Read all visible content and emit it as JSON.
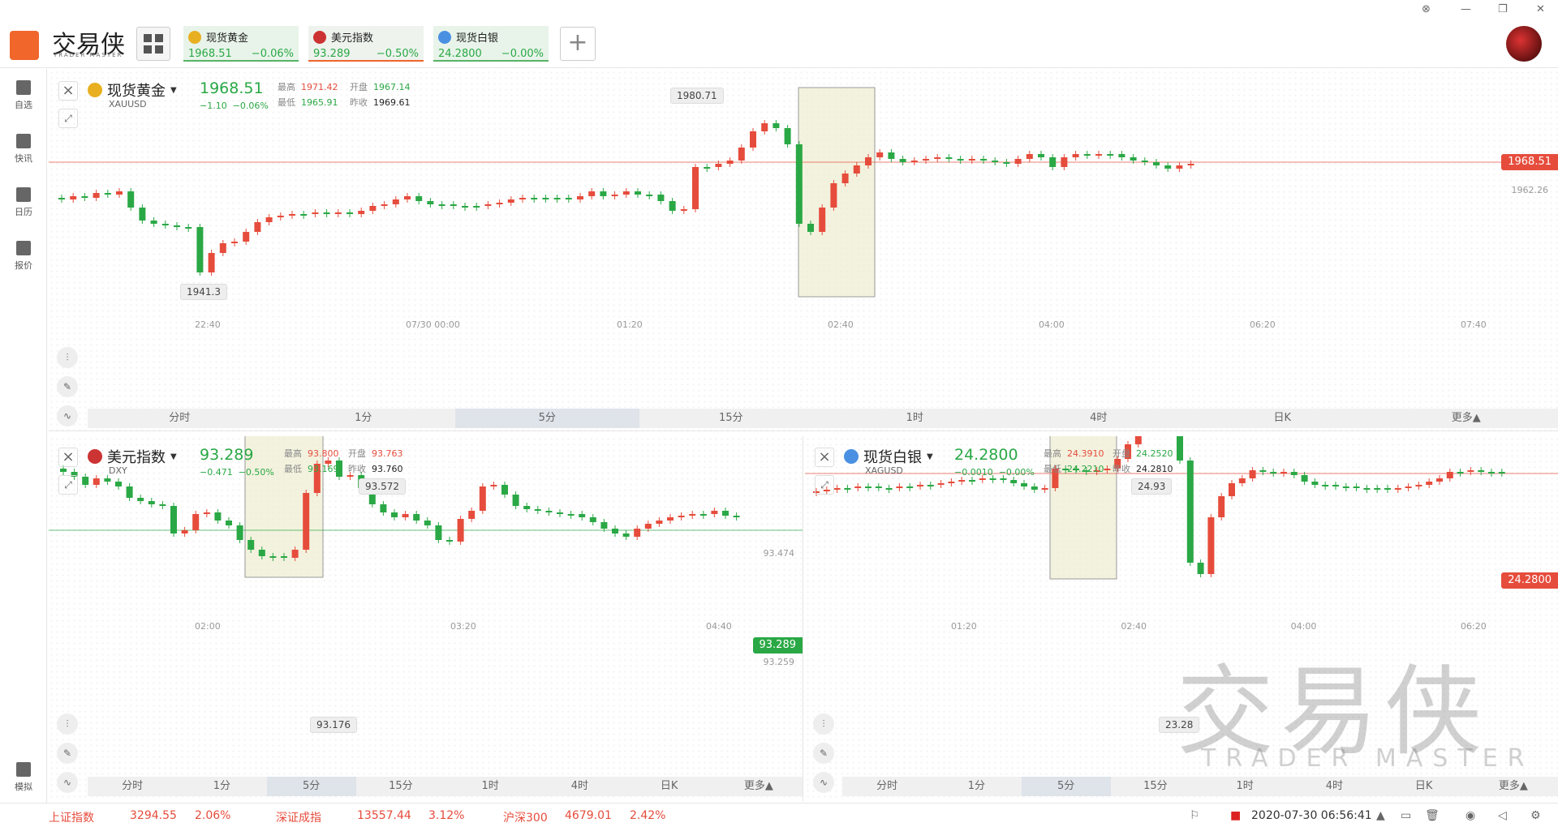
{
  "app": {
    "logo_text": "交易侠",
    "logo_sub": "TRADER MASTER"
  },
  "window_controls": [
    "⊗",
    "—",
    "❐",
    "✕"
  ],
  "quote_tabs": [
    {
      "name": "现货黄金",
      "price": "1968.51",
      "change": "−0.06%",
      "icon_color": "#e8b020"
    },
    {
      "name": "美元指数",
      "price": "93.289",
      "change": "−0.50%",
      "icon_color": "#c33"
    },
    {
      "name": "现货白银",
      "price": "24.2800",
      "change": "−0.00%",
      "icon_color": "#4a90e2"
    }
  ],
  "add_tab": "+",
  "sidebar": [
    {
      "label": "自选"
    },
    {
      "label": "快讯"
    },
    {
      "label": "日历"
    },
    {
      "label": "报价"
    },
    {
      "label": "模拟"
    }
  ],
  "panels": {
    "gold": {
      "name": "现货黄金",
      "code": "XAUUSD",
      "price": "1968.51",
      "chg": "−1.10",
      "pct": "−0.06%",
      "high_lbl": "最高",
      "high": "1971.42",
      "open_lbl": "开盘",
      "open": "1967.14",
      "low_lbl": "最低",
      "low": "1965.91",
      "prev_lbl": "昨收",
      "prev": "1969.61",
      "x_ticks": [
        "22:40",
        "07/30 00:00",
        "01:20",
        "02:40",
        "04:00",
        "06:20",
        "07:40"
      ],
      "sel_high": "1980.71",
      "low_badge": "1941.3",
      "last_tag": "1968.51",
      "right_lbl": "1962.26",
      "timeframes": [
        "分时",
        "1分",
        "5分",
        "15分",
        "1时",
        "4时",
        "日K",
        "更多▲"
      ],
      "active_tf": 2
    },
    "usd": {
      "name": "美元指数",
      "code": "DXY",
      "price": "93.289",
      "chg": "−0.471",
      "pct": "−0.50%",
      "high_lbl": "最高",
      "high": "93.800",
      "open_lbl": "开盘",
      "open": "93.763",
      "low_lbl": "最低",
      "low": "93.169",
      "prev_lbl": "昨收",
      "prev": "93.760",
      "x_ticks": [
        "02:00",
        "03:20",
        "04:40"
      ],
      "sel_high": "93.572",
      "sel_low": "93.176",
      "last_tag": "93.289",
      "right_lbl_top": "93.474",
      "right_lbl_bot": "93.259",
      "timeframes": [
        "分时",
        "1分",
        "5分",
        "15分",
        "1时",
        "4时",
        "日K",
        "更多▲"
      ],
      "active_tf": 2
    },
    "silver": {
      "name": "现货白银",
      "code": "XAGUSD",
      "price": "24.2800",
      "chg": "−0.0010",
      "pct": "−0.00%",
      "high_lbl": "最高",
      "high": "24.3910",
      "open_lbl": "开盘",
      "open": "24.2520",
      "low_lbl": "最低",
      "low": "24.2210",
      "prev_lbl": "昨收",
      "prev": "24.2810",
      "x_ticks": [
        "01:20",
        "02:40",
        "04:00",
        "06:20"
      ],
      "sel_high": "24.93",
      "sel_low": "23.28",
      "last_tag": "24.2800",
      "timeframes": [
        "分时",
        "1分",
        "5分",
        "15分",
        "1时",
        "4时",
        "日K",
        "更多▲"
      ],
      "active_tf": 2
    }
  },
  "watermark": {
    "cn": "交易侠",
    "en": "TRADER MASTER"
  },
  "status_bar": {
    "items": [
      {
        "name": "上证指数",
        "value": "3294.55",
        "pct": "2.06%"
      },
      {
        "name": "深证成指",
        "value": "13557.44",
        "pct": "3.12%"
      },
      {
        "name": "沪深300",
        "value": "4679.01",
        "pct": "2.42%"
      }
    ],
    "datetime": "2020-07-30 06:56:41"
  },
  "colors": {
    "up": "#e64c3c",
    "down": "#2aa845",
    "accent": "#f0662b"
  }
}
